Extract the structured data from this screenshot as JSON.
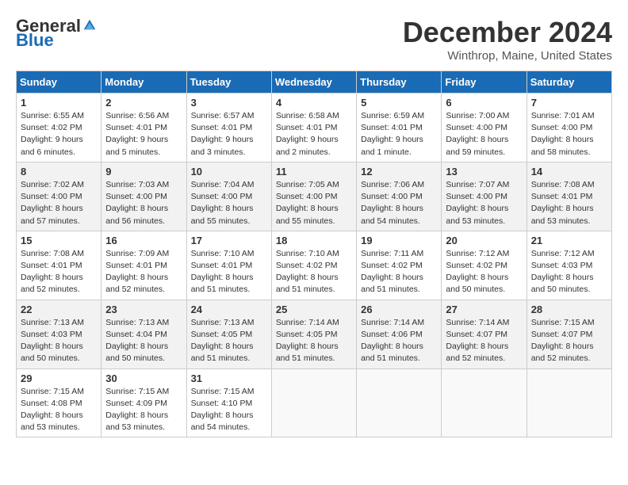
{
  "header": {
    "logo_general": "General",
    "logo_blue": "Blue",
    "month_title": "December 2024",
    "location": "Winthrop, Maine, United States"
  },
  "weekdays": [
    "Sunday",
    "Monday",
    "Tuesday",
    "Wednesday",
    "Thursday",
    "Friday",
    "Saturday"
  ],
  "weeks": [
    [
      {
        "day": "1",
        "sunrise": "6:55 AM",
        "sunset": "4:02 PM",
        "daylight": "9 hours and 6 minutes."
      },
      {
        "day": "2",
        "sunrise": "6:56 AM",
        "sunset": "4:01 PM",
        "daylight": "9 hours and 5 minutes."
      },
      {
        "day": "3",
        "sunrise": "6:57 AM",
        "sunset": "4:01 PM",
        "daylight": "9 hours and 3 minutes."
      },
      {
        "day": "4",
        "sunrise": "6:58 AM",
        "sunset": "4:01 PM",
        "daylight": "9 hours and 2 minutes."
      },
      {
        "day": "5",
        "sunrise": "6:59 AM",
        "sunset": "4:01 PM",
        "daylight": "9 hours and 1 minute."
      },
      {
        "day": "6",
        "sunrise": "7:00 AM",
        "sunset": "4:00 PM",
        "daylight": "8 hours and 59 minutes."
      },
      {
        "day": "7",
        "sunrise": "7:01 AM",
        "sunset": "4:00 PM",
        "daylight": "8 hours and 58 minutes."
      }
    ],
    [
      {
        "day": "8",
        "sunrise": "7:02 AM",
        "sunset": "4:00 PM",
        "daylight": "8 hours and 57 minutes."
      },
      {
        "day": "9",
        "sunrise": "7:03 AM",
        "sunset": "4:00 PM",
        "daylight": "8 hours and 56 minutes."
      },
      {
        "day": "10",
        "sunrise": "7:04 AM",
        "sunset": "4:00 PM",
        "daylight": "8 hours and 55 minutes."
      },
      {
        "day": "11",
        "sunrise": "7:05 AM",
        "sunset": "4:00 PM",
        "daylight": "8 hours and 55 minutes."
      },
      {
        "day": "12",
        "sunrise": "7:06 AM",
        "sunset": "4:00 PM",
        "daylight": "8 hours and 54 minutes."
      },
      {
        "day": "13",
        "sunrise": "7:07 AM",
        "sunset": "4:00 PM",
        "daylight": "8 hours and 53 minutes."
      },
      {
        "day": "14",
        "sunrise": "7:08 AM",
        "sunset": "4:01 PM",
        "daylight": "8 hours and 53 minutes."
      }
    ],
    [
      {
        "day": "15",
        "sunrise": "7:08 AM",
        "sunset": "4:01 PM",
        "daylight": "8 hours and 52 minutes."
      },
      {
        "day": "16",
        "sunrise": "7:09 AM",
        "sunset": "4:01 PM",
        "daylight": "8 hours and 52 minutes."
      },
      {
        "day": "17",
        "sunrise": "7:10 AM",
        "sunset": "4:01 PM",
        "daylight": "8 hours and 51 minutes."
      },
      {
        "day": "18",
        "sunrise": "7:10 AM",
        "sunset": "4:02 PM",
        "daylight": "8 hours and 51 minutes."
      },
      {
        "day": "19",
        "sunrise": "7:11 AM",
        "sunset": "4:02 PM",
        "daylight": "8 hours and 51 minutes."
      },
      {
        "day": "20",
        "sunrise": "7:12 AM",
        "sunset": "4:02 PM",
        "daylight": "8 hours and 50 minutes."
      },
      {
        "day": "21",
        "sunrise": "7:12 AM",
        "sunset": "4:03 PM",
        "daylight": "8 hours and 50 minutes."
      }
    ],
    [
      {
        "day": "22",
        "sunrise": "7:13 AM",
        "sunset": "4:03 PM",
        "daylight": "8 hours and 50 minutes."
      },
      {
        "day": "23",
        "sunrise": "7:13 AM",
        "sunset": "4:04 PM",
        "daylight": "8 hours and 50 minutes."
      },
      {
        "day": "24",
        "sunrise": "7:13 AM",
        "sunset": "4:05 PM",
        "daylight": "8 hours and 51 minutes."
      },
      {
        "day": "25",
        "sunrise": "7:14 AM",
        "sunset": "4:05 PM",
        "daylight": "8 hours and 51 minutes."
      },
      {
        "day": "26",
        "sunrise": "7:14 AM",
        "sunset": "4:06 PM",
        "daylight": "8 hours and 51 minutes."
      },
      {
        "day": "27",
        "sunrise": "7:14 AM",
        "sunset": "4:07 PM",
        "daylight": "8 hours and 52 minutes."
      },
      {
        "day": "28",
        "sunrise": "7:15 AM",
        "sunset": "4:07 PM",
        "daylight": "8 hours and 52 minutes."
      }
    ],
    [
      {
        "day": "29",
        "sunrise": "7:15 AM",
        "sunset": "4:08 PM",
        "daylight": "8 hours and 53 minutes."
      },
      {
        "day": "30",
        "sunrise": "7:15 AM",
        "sunset": "4:09 PM",
        "daylight": "8 hours and 53 minutes."
      },
      {
        "day": "31",
        "sunrise": "7:15 AM",
        "sunset": "4:10 PM",
        "daylight": "8 hours and 54 minutes."
      },
      null,
      null,
      null,
      null
    ]
  ]
}
